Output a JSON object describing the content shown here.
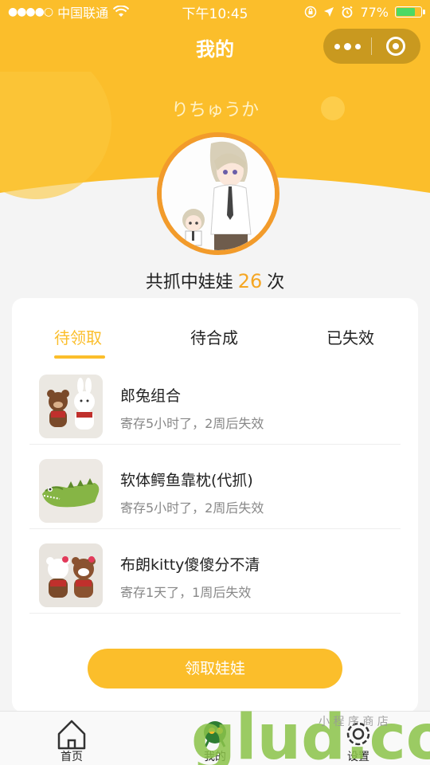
{
  "status_bar": {
    "signal_dots": "●●●●○",
    "carrier": "中国联通",
    "time": "下午10:45",
    "battery": "77%",
    "battery_level": 0.77
  },
  "nav": {
    "title": "我的"
  },
  "profile": {
    "username": "りちゅうか",
    "catch_prefix": "共抓中娃娃",
    "catch_count": "26",
    "catch_suffix": "次"
  },
  "tabs": [
    {
      "label": "待领取",
      "active": true
    },
    {
      "label": "待合成",
      "active": false
    },
    {
      "label": "已失效",
      "active": false
    }
  ],
  "items": [
    {
      "name": "郎兔组合",
      "desc": "寄存5小时了，2周后失效"
    },
    {
      "name": "软体鳄鱼靠枕(代抓)",
      "desc": "寄存5小时了，2周后失效"
    },
    {
      "name": "布朗kitty傻傻分不清",
      "desc": "寄存1天了，1周后失效"
    }
  ],
  "claim_button": "领取娃娃",
  "tabbar": [
    {
      "label": "首页",
      "icon": "home-icon"
    },
    {
      "label": "我的",
      "icon": "profile-icon"
    },
    {
      "label": "设置",
      "icon": "gear-icon"
    }
  ],
  "watermark": {
    "logo": "glud.com",
    "text": "小 程 序 商 店"
  },
  "colors": {
    "accent": "#fbbe2b",
    "count": "#f5a623",
    "avatar_ring": "#f29b2b"
  }
}
